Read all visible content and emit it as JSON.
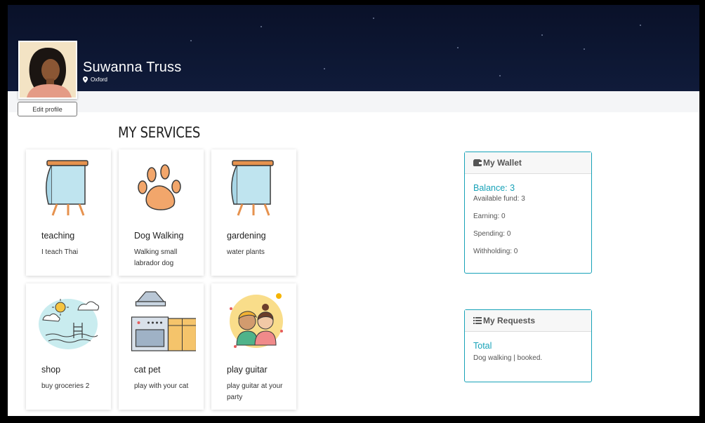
{
  "profile": {
    "name": "Suwanna Truss",
    "location": "Oxford",
    "edit_button": "Edit profile"
  },
  "services": {
    "title": "MY SERVICES",
    "items": [
      {
        "title": "teaching",
        "desc": "I teach Thai",
        "icon": "easel-board-icon"
      },
      {
        "title": "Dog Walking",
        "desc": "Walking small labrador dog",
        "icon": "paw-print-icon"
      },
      {
        "title": "gardening",
        "desc": "water plants",
        "icon": "easel-board-icon"
      },
      {
        "title": "shop",
        "desc": "buy groceries 2",
        "icon": "pool-scene-icon"
      },
      {
        "title": "cat pet",
        "desc": "play with your cat",
        "icon": "kitchen-stove-icon"
      },
      {
        "title": "play guitar",
        "desc": "play guitar at your party",
        "icon": "couple-avatar-icon"
      }
    ]
  },
  "wallet": {
    "title": "My Wallet",
    "balance": "Balance: 3",
    "available": "Available fund: 3",
    "earning": "Earning: 0",
    "spending": "Spending: 0",
    "withholding": "Withholding: 0"
  },
  "requests": {
    "title": "My Requests",
    "total_label": "Total",
    "item": "Dog walking | booked."
  },
  "colors": {
    "accent": "#17a2b8",
    "banner": "#0d1733"
  }
}
